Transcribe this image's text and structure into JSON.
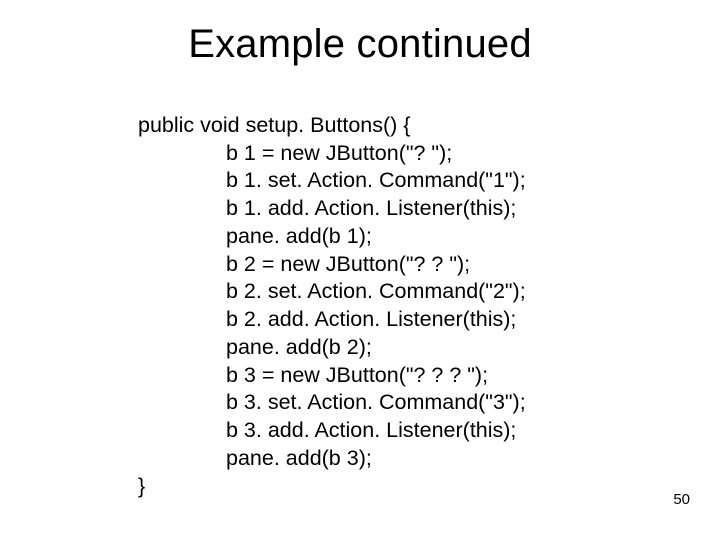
{
  "slide": {
    "title": "Example continued",
    "page_number": "50",
    "code": {
      "signature": "public void setup. Buttons() {",
      "lines": [
        "b 1 = new JButton(\"? \");",
        "b 1. set. Action. Command(\"1\");",
        "b 1. add. Action. Listener(this);",
        "pane. add(b 1);",
        "b 2 = new JButton(\"? ? \");",
        "b 2. set. Action. Command(\"2\");",
        "b 2. add. Action. Listener(this);",
        "pane. add(b 2);",
        "b 3 = new JButton(\"? ? ? \");",
        "b 3. set. Action. Command(\"3\");",
        "b 3. add. Action. Listener(this);",
        "pane. add(b 3);"
      ],
      "close": "}"
    }
  }
}
